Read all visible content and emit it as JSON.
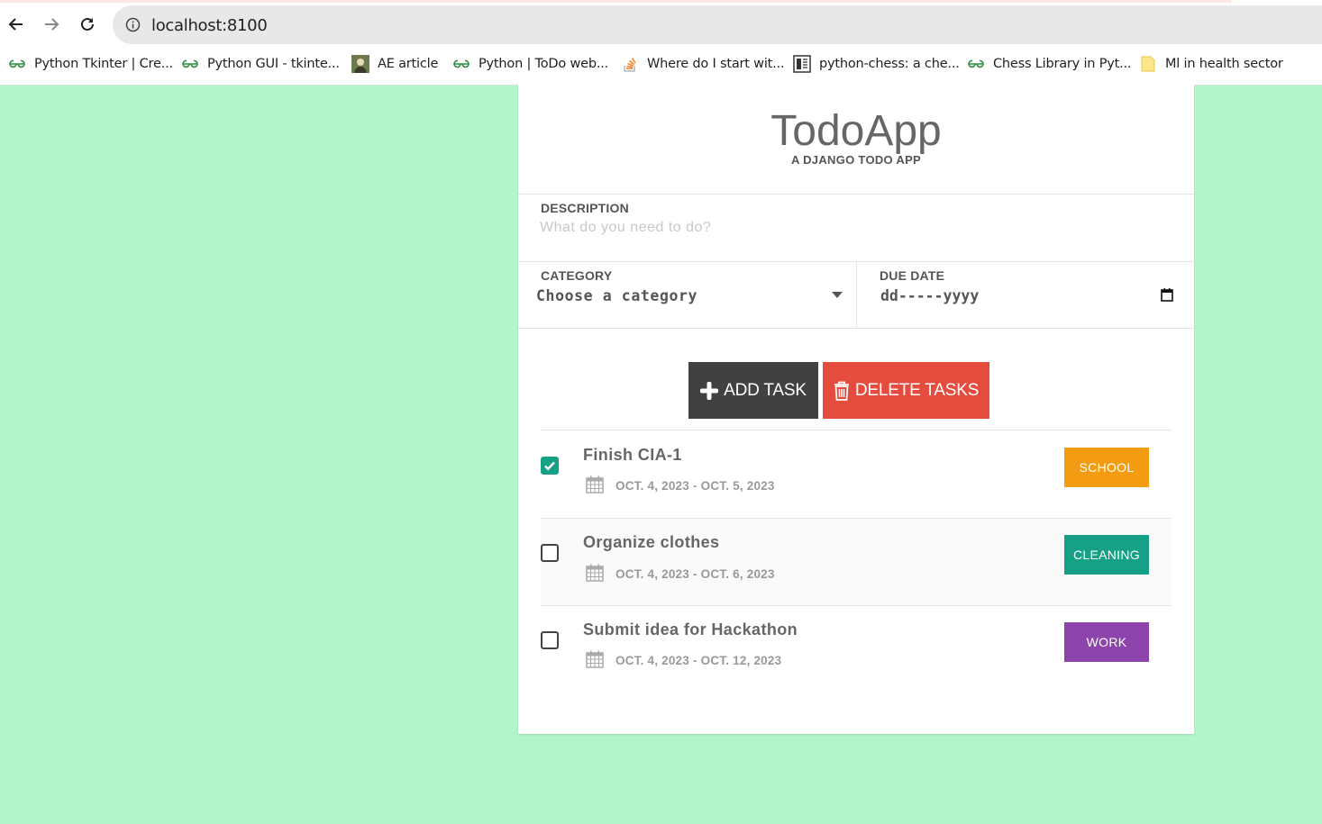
{
  "browser": {
    "url": "localhost:8100",
    "bookmarks": [
      {
        "label": "Python Tkinter | Cre...",
        "icon": "gfg-icon"
      },
      {
        "label": "Python GUI - tkinte...",
        "icon": "gfg-icon"
      },
      {
        "label": "AE article",
        "icon": "avatar-icon"
      },
      {
        "label": "Python | ToDo web...",
        "icon": "gfg-icon"
      },
      {
        "label": "Where do I start wit...",
        "icon": "stackoverflow-icon"
      },
      {
        "label": "python-chess: a che...",
        "icon": "book-icon"
      },
      {
        "label": "Chess Library in Pyt...",
        "icon": "gfg-icon"
      },
      {
        "label": "Ml in health sector",
        "icon": "note-icon"
      }
    ]
  },
  "app": {
    "title": "TodoApp",
    "subtitle": "A DJANGO TODO APP",
    "description": {
      "label": "DESCRIPTION",
      "placeholder": "What do you need to do?",
      "value": ""
    },
    "category": {
      "label": "CATEGORY",
      "selected": "Choose a category"
    },
    "due_date": {
      "label": "DUE DATE",
      "value": "dd-----yyyy"
    },
    "buttons": {
      "add": "ADD TASK",
      "delete": "DELETE TASKS"
    },
    "colors": {
      "background": "#b2f5cb",
      "add_button": "#414141",
      "delete_button": "#e64c3d",
      "school": "#f39c12",
      "cleaning": "#16a085",
      "work": "#8e44ad"
    },
    "tasks": [
      {
        "name": "Finish CIA-1",
        "start": "OCT. 4, 2023",
        "end": "OCT. 5, 2023",
        "sep": "-",
        "category": "SCHOOL",
        "checked": true
      },
      {
        "name": "Organize clothes",
        "start": "OCT. 4, 2023",
        "end": "OCT. 6, 2023",
        "sep": "-",
        "category": "CLEANING",
        "checked": false
      },
      {
        "name": "Submit idea for Hackathon",
        "start": "OCT. 4, 2023",
        "end": "OCT. 12, 2023",
        "sep": "-",
        "category": "WORK",
        "checked": false
      }
    ]
  }
}
